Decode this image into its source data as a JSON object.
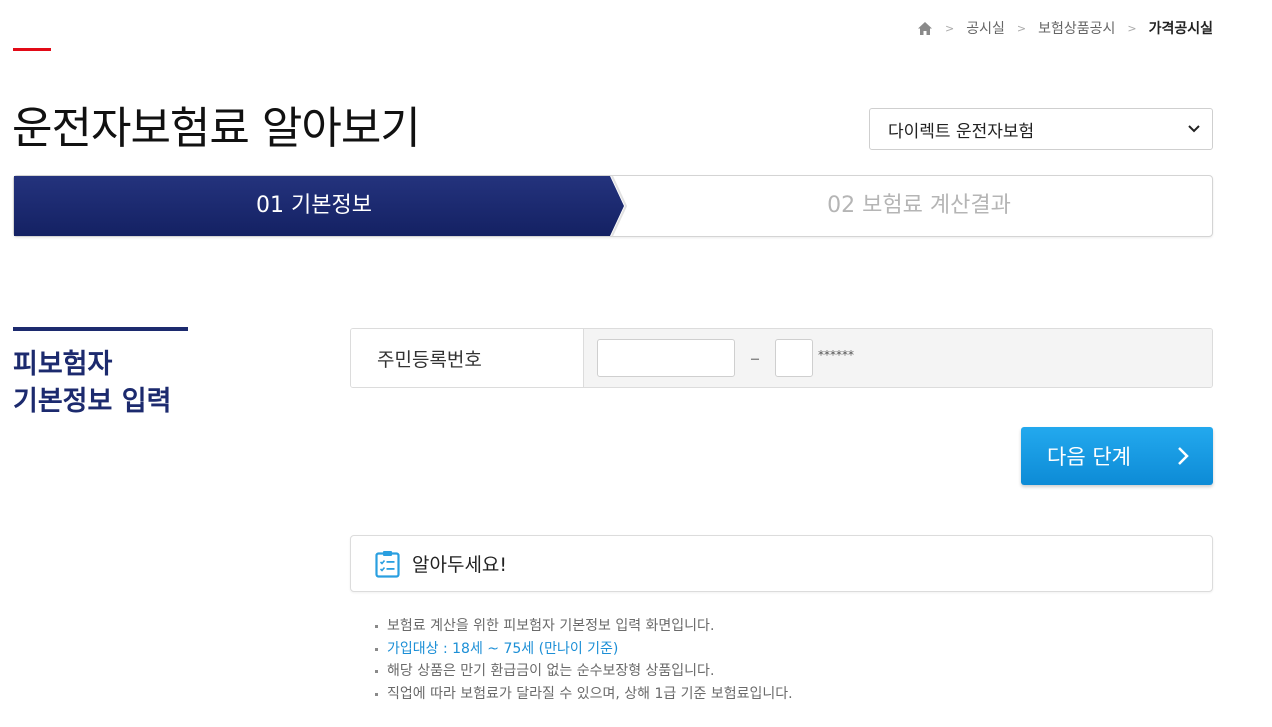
{
  "breadcrumb": {
    "items": [
      "공시실",
      "보험상품공시",
      "가격공시실"
    ],
    "separator": ">"
  },
  "page": {
    "title": "운전자보험료 알아보기"
  },
  "product_select": {
    "value": "다이렉트 운전자보험"
  },
  "steps": [
    {
      "label": "01 기본정보",
      "active": true
    },
    {
      "label": "02 보험료 계산결과",
      "active": false
    }
  ],
  "section": {
    "title_line1": "피보험자",
    "title_line2": "기본정보 입력"
  },
  "form": {
    "ssn_label": "주민등록번호",
    "ssn_front_value": "",
    "ssn_back_value": "",
    "separator": "–",
    "mask": "******"
  },
  "next_button": {
    "label": "다음 단계"
  },
  "notice": {
    "title": "알아두세요!",
    "items": [
      "보험료 계산을 위한 피보험자 기본정보 입력 화면입니다.",
      "가입대상 : 18세 ~ 75세 (만나이 기준)",
      "해당 상품은 만기 환급금이 없는 순수보장형 상품입니다.",
      "직업에 따라 보험료가 달라질 수 있으며, 상해 1급 기준 보험료입니다."
    ]
  },
  "colors": {
    "accent_red": "#e20a17",
    "navy": "#1c2a6e",
    "button_blue": "#1599e2",
    "highlight_blue": "#1c8fd6"
  }
}
